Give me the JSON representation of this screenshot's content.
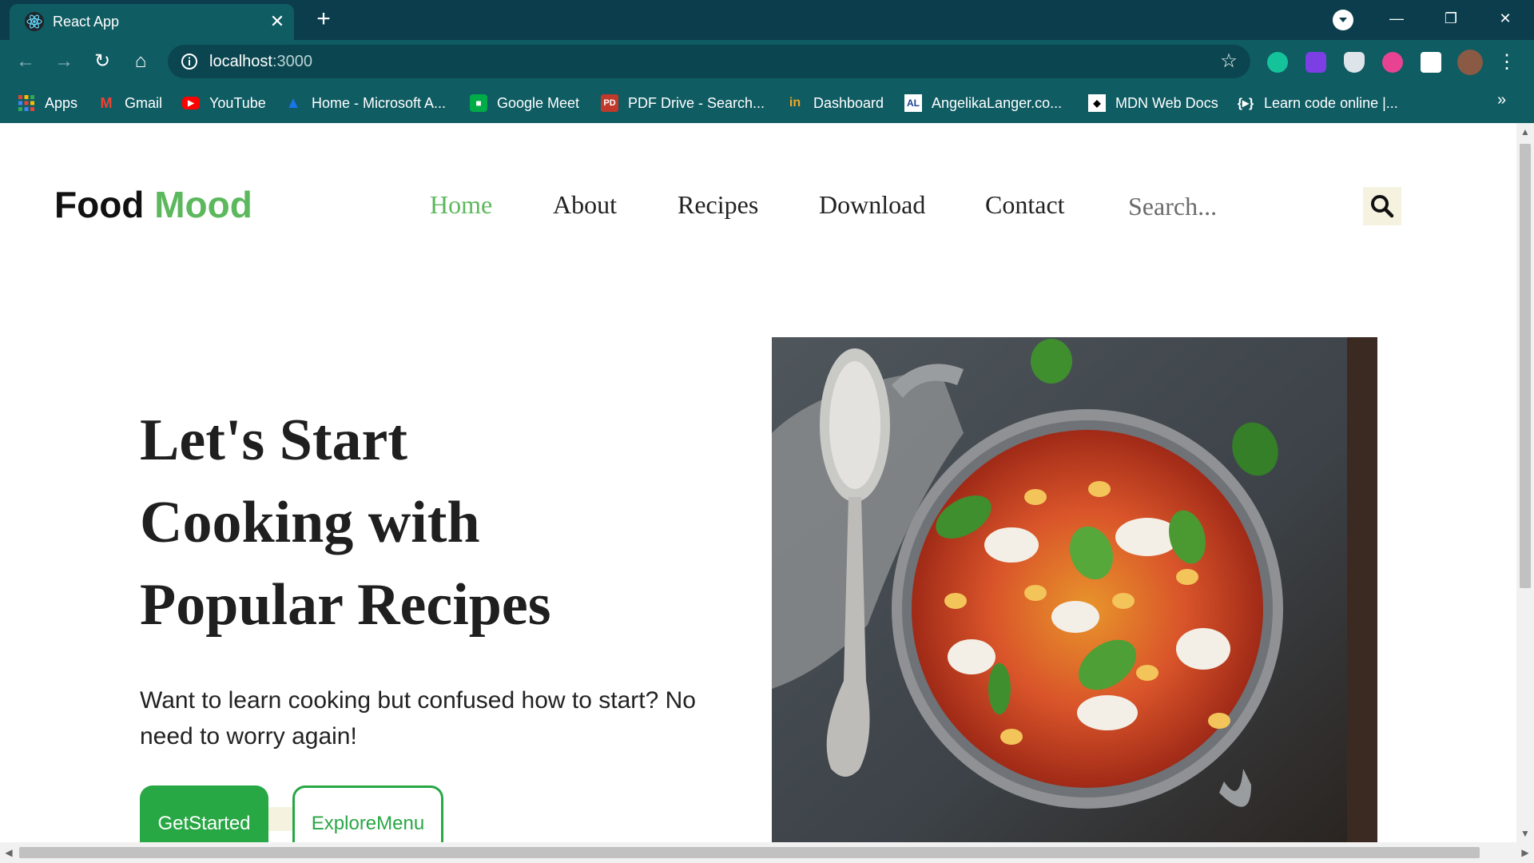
{
  "browser": {
    "tab_title": "React App",
    "tab_close": "✕",
    "new_tab": "+",
    "window_buttons": {
      "minimize": "—",
      "restore": "❐",
      "close": "✕"
    },
    "nav": {
      "back": "←",
      "forward": "→",
      "reload": "↻",
      "home": "⌂"
    },
    "url_host": "localhost",
    "url_port": ":3000",
    "star": "☆",
    "menu": "⋮",
    "bookmarks": [
      {
        "label": "Apps",
        "icon": "apps-grid-icon",
        "color": "#e94235"
      },
      {
        "label": "Gmail",
        "icon": "gmail-icon",
        "color": "#ea4335"
      },
      {
        "label": "YouTube",
        "icon": "youtube-icon",
        "color": "#ff0000"
      },
      {
        "label": "Home - Microsoft A...",
        "icon": "azure-icon",
        "color": "#1a73e8"
      },
      {
        "label": "Google Meet",
        "icon": "google-meet-icon",
        "color": "#00ac47"
      },
      {
        "label": "PDF Drive - Search...",
        "icon": "pdf-drive-icon",
        "color": "#c0392b"
      },
      {
        "label": "Dashboard",
        "icon": "dashboard-icon",
        "color": "#f5a623"
      },
      {
        "label": "AngelikaLanger.co...",
        "icon": "angelika-icon",
        "color": "#1c3f94"
      },
      {
        "label": "MDN Web Docs",
        "icon": "mdn-icon",
        "color": "#000000"
      },
      {
        "label": "Learn code online |...",
        "icon": "code-brackets-icon",
        "color": "#ffffff"
      }
    ],
    "bookmarks_more": "»"
  },
  "page": {
    "brand_first": "Food",
    "brand_second": "Mood",
    "nav": [
      "Home",
      "About",
      "Recipes",
      "Download",
      "Contact"
    ],
    "search_placeholder": "Search...",
    "hero_title_lines": [
      "Let's Start",
      "Cooking with",
      "Popular Recipes"
    ],
    "hero_sub": "Want to learn cooking but confused how to start? No need to worry again!",
    "primary_button": "GetStarted",
    "secondary_button": "ExploreMenu",
    "colors": {
      "accent": "#5cb85c",
      "button": "#28a745",
      "chrome": "#0f5c63"
    }
  }
}
